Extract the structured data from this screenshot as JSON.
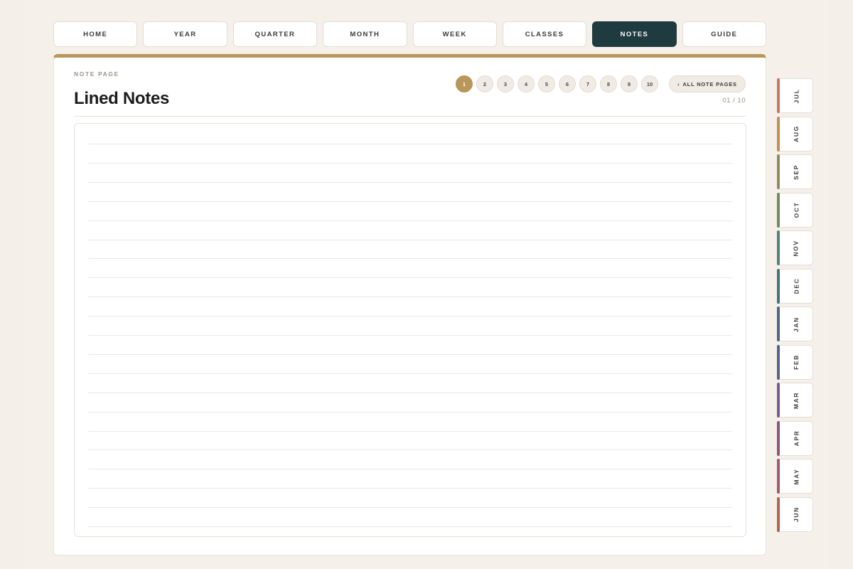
{
  "nav": [
    {
      "label": "HOME",
      "active": false
    },
    {
      "label": "YEAR",
      "active": false
    },
    {
      "label": "QUARTER",
      "active": false
    },
    {
      "label": "MONTH",
      "active": false
    },
    {
      "label": "WEEK",
      "active": false
    },
    {
      "label": "CLASSES",
      "active": false
    },
    {
      "label": "NOTES",
      "active": true
    },
    {
      "label": "GUIDE",
      "active": false
    }
  ],
  "header": {
    "kicker": "NOTE PAGE",
    "title": "Lined Notes",
    "counter": "01 / 10",
    "all_pages_arrow": "‹",
    "all_pages_label": "ALL NOTE PAGES"
  },
  "pager": {
    "current": 1,
    "pages": [
      "1",
      "2",
      "3",
      "4",
      "5",
      "6",
      "7",
      "8",
      "9",
      "10"
    ]
  },
  "months": [
    {
      "label": "JUL",
      "color": "#c9765a"
    },
    {
      "label": "AUG",
      "color": "#c08f54"
    },
    {
      "label": "SEP",
      "color": "#8f8d55"
    },
    {
      "label": "OCT",
      "color": "#748a5e"
    },
    {
      "label": "NOV",
      "color": "#4d8274"
    },
    {
      "label": "DEC",
      "color": "#46727c"
    },
    {
      "label": "JAN",
      "color": "#4d6686"
    },
    {
      "label": "FEB",
      "color": "#5a5f92"
    },
    {
      "label": "MAR",
      "color": "#765c8e"
    },
    {
      "label": "APR",
      "color": "#8d557a"
    },
    {
      "label": "MAY",
      "color": "#a55a6c"
    },
    {
      "label": "JUN",
      "color": "#b5634f"
    }
  ],
  "colors": {
    "accent": "#b9965a",
    "active_nav": "#1f3b40"
  }
}
